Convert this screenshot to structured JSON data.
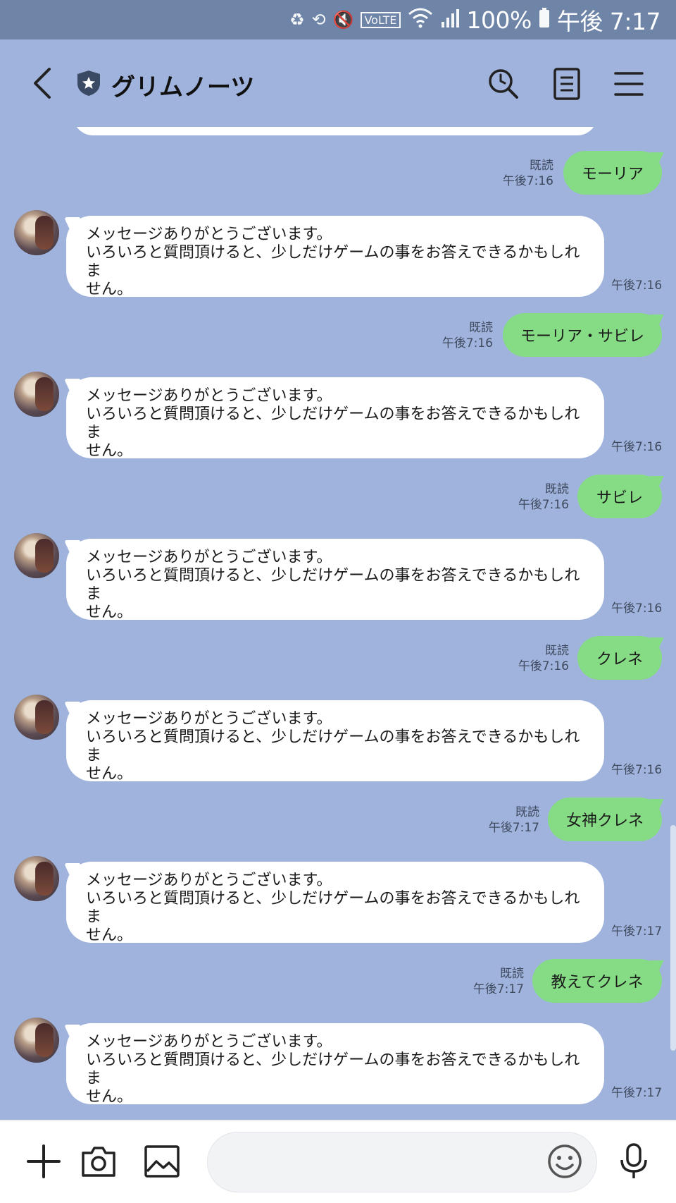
{
  "status_bar": {
    "battery_percent": "100%",
    "time": "午後 7:17"
  },
  "header": {
    "title": "グリムノーツ"
  },
  "messages": [
    {
      "dir": "out",
      "text": "モーリア",
      "read": "既読",
      "time": "午後7:16"
    },
    {
      "dir": "in",
      "text": "メッセージありがとうございます。\nいろいろと質問頂けると、少しだけゲームの事をお答えできるかもしれま\nせん。",
      "time": "午後7:16"
    },
    {
      "dir": "out",
      "text": "モーリア・サビレ",
      "read": "既読",
      "time": "午後7:16"
    },
    {
      "dir": "in",
      "text": "メッセージありがとうございます。\nいろいろと質問頂けると、少しだけゲームの事をお答えできるかもしれま\nせん。",
      "time": "午後7:16"
    },
    {
      "dir": "out",
      "text": "サビレ",
      "read": "既読",
      "time": "午後7:16"
    },
    {
      "dir": "in",
      "text": "メッセージありがとうございます。\nいろいろと質問頂けると、少しだけゲームの事をお答えできるかもしれま\nせん。",
      "time": "午後7:16"
    },
    {
      "dir": "out",
      "text": "クレネ",
      "read": "既読",
      "time": "午後7:16"
    },
    {
      "dir": "in",
      "text": "メッセージありがとうございます。\nいろいろと質問頂けると、少しだけゲームの事をお答えできるかもしれま\nせん。",
      "time": "午後7:16"
    },
    {
      "dir": "out",
      "text": "女神クレネ",
      "read": "既読",
      "time": "午後7:17"
    },
    {
      "dir": "in",
      "text": "メッセージありがとうございます。\nいろいろと質問頂けると、少しだけゲームの事をお答えできるかもしれま\nせん。",
      "time": "午後7:17"
    },
    {
      "dir": "out",
      "text": "教えてクレネ",
      "read": "既読",
      "time": "午後7:17"
    },
    {
      "dir": "in",
      "text": "メッセージありがとうございます。\nいろいろと質問頂けると、少しだけゲームの事をお答えできるかもしれま\nせん。",
      "time": "午後7:17"
    }
  ],
  "input": {
    "placeholder": ""
  },
  "colors": {
    "chat_background": "#9fb3dc",
    "status_bar": "#6f85a8",
    "outgoing_bubble": "#86dc85",
    "incoming_bubble": "#ffffff"
  },
  "icons": {
    "header": [
      "back-icon",
      "shield-icon",
      "search-icon",
      "notes-icon",
      "menu-icon"
    ],
    "input_bar": [
      "plus-icon",
      "camera-icon",
      "image-icon",
      "emoji-icon",
      "mic-icon"
    ]
  }
}
